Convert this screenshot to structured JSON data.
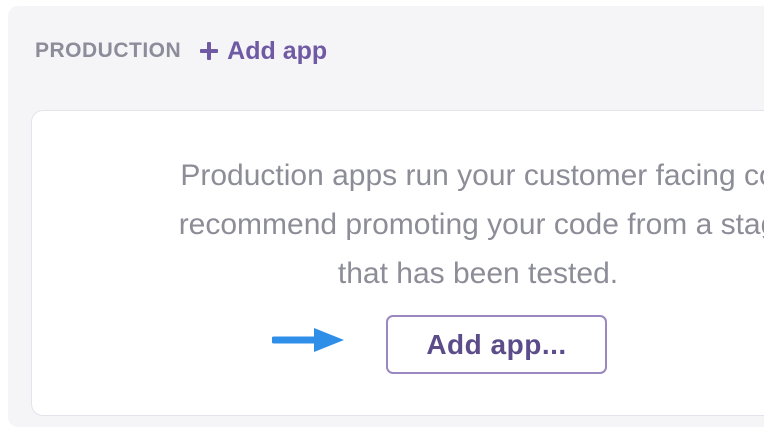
{
  "section": {
    "label": "PRODUCTION",
    "add_link_label": "Add app"
  },
  "empty_state": {
    "message_lines": [
      "Production apps run your customer facing co",
      "recommend promoting your code from a stag",
      "that has been tested."
    ],
    "button_label": "Add app..."
  },
  "icons": {
    "plus": "plus-icon",
    "arrow": "right-arrow-icon"
  },
  "colors": {
    "accent": "#6f5aa3",
    "arrow": "#2f8fe8",
    "text_muted": "#8d8d98"
  }
}
